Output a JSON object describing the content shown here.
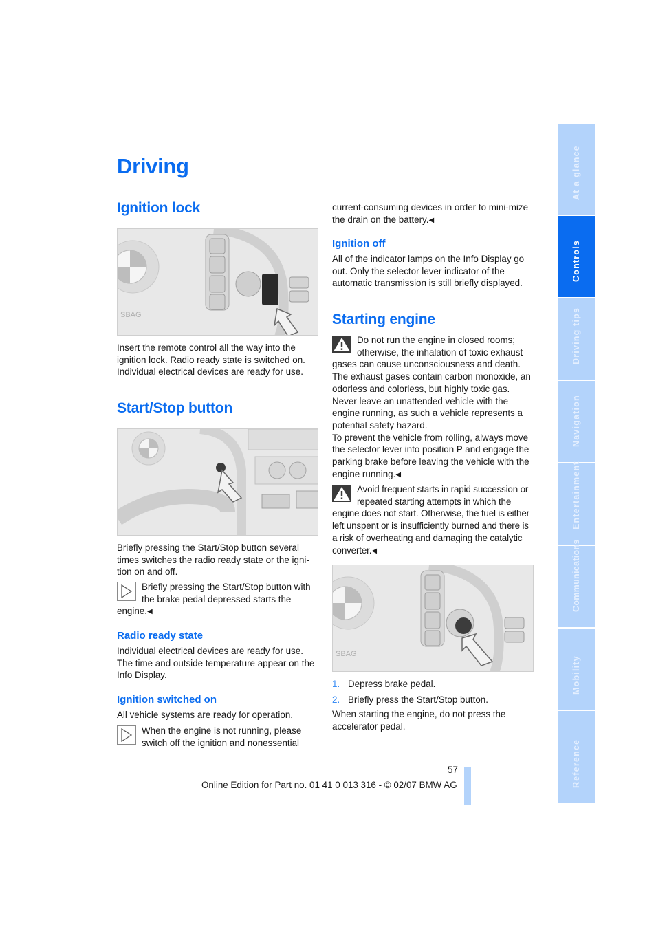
{
  "page": {
    "title": "Driving",
    "page_number": "57",
    "footer": "Online Edition for Part no. 01 41 0 013 316 - © 02/07 BMW AG",
    "accent_color": "#0a6cf0",
    "tab_color": "#b3d3fb"
  },
  "side_tabs": [
    {
      "label": "At a glance",
      "active": false
    },
    {
      "label": "Controls",
      "active": true
    },
    {
      "label": "Driving tips",
      "active": false
    },
    {
      "label": "Navigation",
      "active": false
    },
    {
      "label": "Entertainment",
      "active": false
    },
    {
      "label": "Communications",
      "active": false
    },
    {
      "label": "Mobility",
      "active": false
    },
    {
      "label": "Reference",
      "active": false
    }
  ],
  "icons": {
    "note": "note-arrow-icon",
    "warning": "warning-triangle-icon",
    "end_mark": "◀"
  },
  "left": {
    "ignition_lock": {
      "heading": "Ignition lock",
      "figure": "Illustration: remote control inserted into ignition lock next to steering wheel",
      "text": "Insert the remote control all the way into the ignition lock. Radio ready state is switched on. Individual electrical devices are ready for use."
    },
    "start_stop": {
      "heading": "Start/Stop button",
      "figure": "Illustration: Start/Stop button behind steering wheel",
      "text": "Briefly pressing the Start/Stop button several times switches the radio ready state or the igni-tion on and off.",
      "note": "Briefly pressing the Start/Stop button with the brake pedal depressed starts the engine."
    },
    "radio_ready": {
      "heading": "Radio ready state",
      "text": "Individual electrical devices are ready for use. The time and outside temperature appear on the Info Display."
    },
    "ignition_on": {
      "heading": "Ignition switched on",
      "text": "All vehicle systems are ready for operation.",
      "note": "When the engine is not running, please switch off the ignition and nonessential"
    }
  },
  "right": {
    "note_continued": "current-consuming devices in order to mini-mize the drain on the battery.",
    "ignition_off": {
      "heading": "Ignition off",
      "text": "All of the indicator lamps on the Info Display go out. Only the selector lever indicator of the automatic transmission is still briefly displayed."
    },
    "starting_engine": {
      "heading": "Starting engine",
      "warning1": "Do not run the engine in closed rooms; otherwise, the inhalation of toxic exhaust gases can cause unconsciousness and death. The exhaust gases contain carbon monoxide, an odorless and colorless, but highly toxic gas. Never leave an unattended vehicle with the engine running, as such a vehicle represents a potential safety hazard.",
      "warning1b": "To prevent the vehicle from rolling, always move the selector lever into position P and engage the parking brake before leaving the vehicle with the engine running.",
      "warning2": "Avoid frequent starts in rapid succession or repeated starting attempts in which the engine does not start. Otherwise, the fuel is either left unspent or is insufficiently burned and there is a risk of overheating and damaging the catalytic converter.",
      "figure": "Illustration: pressing the Start/Stop button",
      "steps": [
        {
          "num": "1.",
          "text": "Depress brake pedal."
        },
        {
          "num": "2.",
          "text": "Briefly press the Start/Stop button."
        }
      ],
      "after": "When starting the engine, do not press the accelerator pedal."
    }
  }
}
